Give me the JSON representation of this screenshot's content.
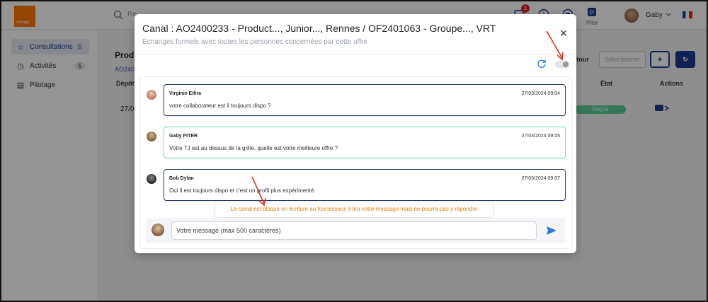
{
  "app": {
    "logo_text": "orange",
    "search_placeholder": "Re",
    "notif_count": "1",
    "piter_label": "Piter",
    "user_name": "Gaby"
  },
  "sidebar": {
    "items": [
      {
        "label": "Consultations",
        "count": "5"
      },
      {
        "label": "Activités",
        "count": "5"
      },
      {
        "label": "Pilotage",
        "count": ""
      }
    ]
  },
  "background": {
    "title": "Produ",
    "link": "AO240",
    "col_depot": "Dépôt",
    "col_etat": "État",
    "col_actions": "Actions",
    "row_date": "27/03",
    "status": "Reçus",
    "btn_retour": "tour",
    "btn_selectionner": "Sélectionner"
  },
  "modal": {
    "title": "Canal : AO2400233 - Product..., Junior..., Rennes / OF2401063 - Groupe..., VRT",
    "subtitle": "Échanges formels avec toutes les personnes concernées par cette offre",
    "close_glyph": "×",
    "messages": [
      {
        "author": "Virginie Eifira",
        "date": "27/03/2024 09:04",
        "text": "votre collaborateur est il toujours dispo ?"
      },
      {
        "author": "Gaby PITER",
        "date": "27/03/2024 09:05",
        "text": "Votre TJ est au dessus de la grille, quelle est votre meilleure offre ?"
      },
      {
        "author": "Bob Dylan",
        "date": "27/03/2024 09:07",
        "text": "Oui il est toujours dispo et c'est un profil plus expérimenté."
      }
    ],
    "tooltip": "Le canal est bloqué en écriture au fournisseur, il lira votre message mais ne pourra pas y répondre",
    "compose_placeholder": "Votre message (max 500 caractères)"
  },
  "colors": {
    "accent": "#1d3c8c",
    "client_border": "#2b3a6b",
    "own_border": "#7ad7ad",
    "tooltip_text": "#e67e00",
    "annotation_arrow": "#e0301e"
  }
}
